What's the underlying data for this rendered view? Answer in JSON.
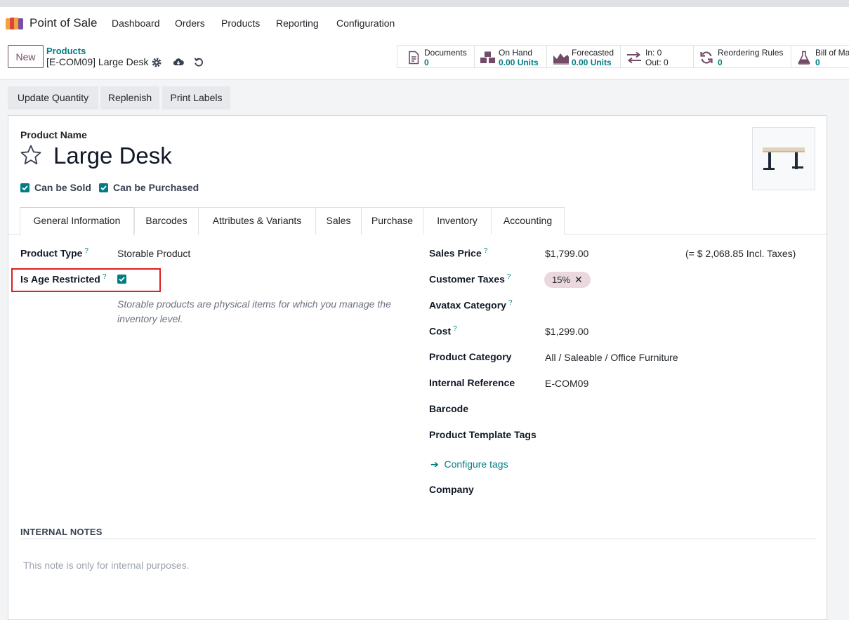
{
  "navbar": {
    "app_name": "Point of Sale",
    "menu": [
      "Dashboard",
      "Orders",
      "Products",
      "Reporting",
      "Configuration"
    ]
  },
  "control": {
    "new_label": "New",
    "breadcrumb_parent": "Products",
    "breadcrumb_current": "[E-COM09] Large Desk"
  },
  "smart_buttons": [
    {
      "icon": "document-icon",
      "label": "Documents",
      "value": "0"
    },
    {
      "icon": "cubes-icon",
      "label": "On Hand",
      "value": "0.00 Units"
    },
    {
      "icon": "area-chart-icon",
      "label": "Forecasted",
      "value": "0.00 Units"
    },
    {
      "icon": "exchange-icon",
      "label": "In: 0",
      "value": "Out: 0"
    },
    {
      "icon": "refresh-icon",
      "label": "Reordering Rules",
      "value": "0"
    },
    {
      "icon": "flask-icon",
      "label": "Bill of Ma",
      "value": "0"
    }
  ],
  "actions": [
    "Update Quantity",
    "Replenish",
    "Print Labels"
  ],
  "product": {
    "name_label": "Product Name",
    "name": "Large Desk",
    "can_be_sold": "Can be Sold",
    "can_be_purchased": "Can be Purchased"
  },
  "tabs": [
    "General Information",
    "Barcodes",
    "Attributes & Variants",
    "Sales",
    "Purchase",
    "Inventory",
    "Accounting"
  ],
  "left_fields": {
    "product_type_label": "Product Type",
    "product_type_value": "Storable Product",
    "age_restricted_label": "Is Age Restricted",
    "help_text": "Storable products are physical items for which you manage the inventory level."
  },
  "right_fields": {
    "sales_price_label": "Sales Price",
    "sales_price_value": "$1,799.00",
    "incl_taxes": "(= $ 2,068.85 Incl. Taxes)",
    "customer_taxes_label": "Customer Taxes",
    "customer_taxes_tag": "15%",
    "avatax_label": "Avatax Category",
    "cost_label": "Cost",
    "cost_value": "$1,299.00",
    "category_label": "Product Category",
    "category_value": "All / Saleable / Office Furniture",
    "internal_ref_label": "Internal Reference",
    "internal_ref_value": "E-COM09",
    "barcode_label": "Barcode",
    "template_tags_label": "Product Template Tags",
    "configure_tags": "Configure tags",
    "company_label": "Company",
    "help_mark": "?"
  },
  "notes": {
    "title": "INTERNAL NOTES",
    "placeholder": "This note is only for internal purposes."
  },
  "colors": {
    "brand": "#714b67",
    "accent": "#017e84",
    "highlight": "#e01e1e"
  }
}
